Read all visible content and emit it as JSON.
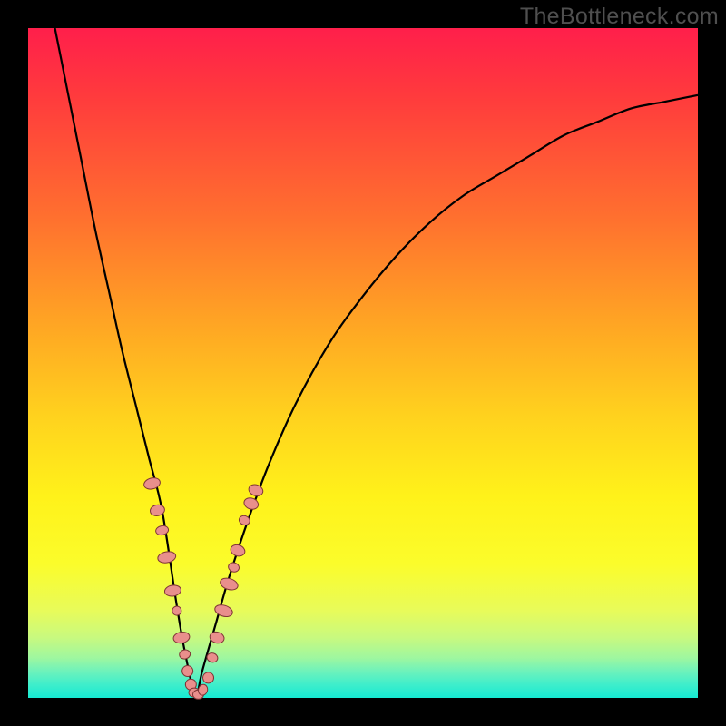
{
  "watermark": "TheBottleneck.com",
  "colors": {
    "frame": "#000000",
    "curve": "#000000",
    "marker_fill": "#e98f8c",
    "marker_stroke": "#7f3535"
  },
  "chart_data": {
    "type": "line",
    "title": "",
    "xlabel": "",
    "ylabel": "",
    "xlim": [
      0,
      100
    ],
    "ylim": [
      0,
      100
    ],
    "grid": false,
    "legend": false,
    "annotations": [
      "TheBottleneck.com"
    ],
    "series": [
      {
        "name": "bottleneck-curve",
        "x": [
          4,
          6,
          8,
          10,
          12,
          14,
          16,
          18,
          20,
          22,
          23,
          24,
          25,
          26,
          28,
          30,
          33,
          36,
          40,
          45,
          50,
          55,
          60,
          65,
          70,
          75,
          80,
          85,
          90,
          95,
          100
        ],
        "y": [
          100,
          90,
          80,
          70,
          61,
          52,
          44,
          36,
          28,
          15,
          9,
          4,
          0,
          4,
          11,
          18,
          27,
          35,
          44,
          53,
          60,
          66,
          71,
          75,
          78,
          81,
          84,
          86,
          88,
          89,
          90
        ]
      }
    ],
    "markers": [
      {
        "x": 18.5,
        "y": 32,
        "rx": 6,
        "ry": 9
      },
      {
        "x": 19.3,
        "y": 28,
        "rx": 6,
        "ry": 8
      },
      {
        "x": 20.0,
        "y": 25,
        "rx": 5,
        "ry": 7
      },
      {
        "x": 20.7,
        "y": 21,
        "rx": 6,
        "ry": 10
      },
      {
        "x": 21.6,
        "y": 16,
        "rx": 6,
        "ry": 9
      },
      {
        "x": 22.2,
        "y": 13,
        "rx": 5,
        "ry": 5
      },
      {
        "x": 22.9,
        "y": 9,
        "rx": 6,
        "ry": 9
      },
      {
        "x": 23.4,
        "y": 6.5,
        "rx": 5,
        "ry": 6
      },
      {
        "x": 23.8,
        "y": 4,
        "rx": 6,
        "ry": 6
      },
      {
        "x": 24.3,
        "y": 2,
        "rx": 6,
        "ry": 6
      },
      {
        "x": 24.8,
        "y": 0.8,
        "rx": 6,
        "ry": 5
      },
      {
        "x": 25.4,
        "y": 0.5,
        "rx": 6,
        "ry": 5
      },
      {
        "x": 26.1,
        "y": 1.2,
        "rx": 6,
        "ry": 5
      },
      {
        "x": 26.9,
        "y": 3,
        "rx": 6,
        "ry": 6
      },
      {
        "x": 27.5,
        "y": 6,
        "rx": 5,
        "ry": 6
      },
      {
        "x": 28.2,
        "y": 9,
        "rx": 6,
        "ry": 8
      },
      {
        "x": 29.2,
        "y": 13,
        "rx": 6,
        "ry": 10
      },
      {
        "x": 30.0,
        "y": 17,
        "rx": 6,
        "ry": 10
      },
      {
        "x": 30.7,
        "y": 19.5,
        "rx": 5,
        "ry": 6
      },
      {
        "x": 31.3,
        "y": 22,
        "rx": 6,
        "ry": 8
      },
      {
        "x": 32.3,
        "y": 26.5,
        "rx": 5,
        "ry": 6
      },
      {
        "x": 33.3,
        "y": 29,
        "rx": 6,
        "ry": 8
      },
      {
        "x": 34.0,
        "y": 31,
        "rx": 6,
        "ry": 8
      }
    ]
  }
}
